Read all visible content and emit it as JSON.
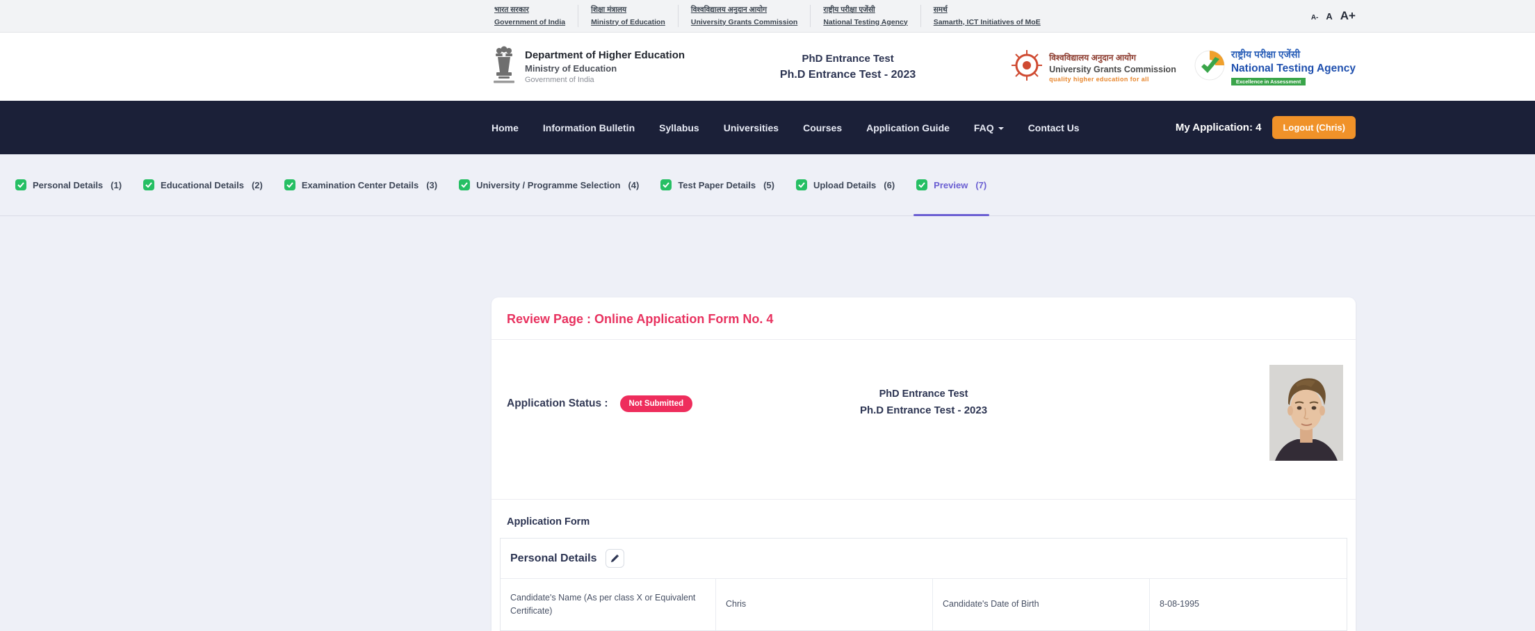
{
  "top_bar": {
    "links": [
      {
        "hi": "भारत सरकार",
        "en": "Government of India"
      },
      {
        "hi": "शिक्षा मंत्रालय",
        "en": "Ministry of Education"
      },
      {
        "hi": "विश्वविद्यालय अनुदान आयोग",
        "en": "University Grants Commission"
      },
      {
        "hi": "राष्ट्रीय परीक्षा एजेंसी",
        "en": "National Testing Agency"
      },
      {
        "hi": "समर्थ",
        "en": "Samarth, ICT Initiatives of MoE"
      }
    ],
    "font_controls": {
      "decrease": "A-",
      "normal": "A",
      "increase": "A+"
    }
  },
  "header": {
    "department": {
      "line1": "Department of Higher Education",
      "line2": "Ministry of Education",
      "line3": "Government of India"
    },
    "test_title": {
      "line1": "PhD Entrance Test",
      "line2": "Ph.D Entrance Test - 2023"
    },
    "ugc": {
      "hi": "विश्वविद्यालय अनुदान आयोग",
      "en": "University Grants Commission",
      "tagline": "quality higher education for all"
    },
    "nta": {
      "hi": "राष्ट्रीय परीक्षा एजेंसी",
      "en": "National Testing Agency",
      "badge": "Excellence in Assessment"
    }
  },
  "nav": {
    "items": [
      {
        "label": "Home"
      },
      {
        "label": "Information Bulletin"
      },
      {
        "label": "Syllabus"
      },
      {
        "label": "Universities"
      },
      {
        "label": "Courses"
      },
      {
        "label": "Application Guide"
      },
      {
        "label": "FAQ"
      },
      {
        "label": "Contact Us"
      }
    ],
    "my_application": "My Application: 4",
    "logout_label": "Logout (Chris)"
  },
  "steps": [
    {
      "label": "Personal Details",
      "num": "(1)"
    },
    {
      "label": "Educational Details",
      "num": "(2)"
    },
    {
      "label": "Examination Center Details",
      "num": "(3)"
    },
    {
      "label": "University / Programme Selection",
      "num": "(4)"
    },
    {
      "label": "Test Paper Details",
      "num": "(5)"
    },
    {
      "label": "Upload Details",
      "num": "(6)"
    },
    {
      "label": "Preview",
      "num": "(7)"
    }
  ],
  "review": {
    "title": "Review Page : Online Application Form No. 4",
    "status_label": "Application Status :",
    "status_badge": "Not Submitted",
    "test_line1": "PhD Entrance Test",
    "test_line2": "Ph.D Entrance Test - 2023",
    "form_label": "Application Form",
    "section": {
      "title": "Personal Details",
      "row1": {
        "label1": "Candidate's Name (As per class X or Equivalent Certificate)",
        "value1": "Chris",
        "label2": "Candidate's Date of Birth",
        "value2": "8-08-1995"
      }
    }
  },
  "colors": {
    "navbar_bg": "#1b2038",
    "accent_orange": "#f09229",
    "step_check_green": "#26bf64",
    "active_step_purple": "#6a5ed2",
    "review_title_crimson": "#e8325f",
    "status_badge_pink": "#ee2d5c",
    "navy_text": "#2c3452",
    "page_bg": "#eef0f7"
  }
}
